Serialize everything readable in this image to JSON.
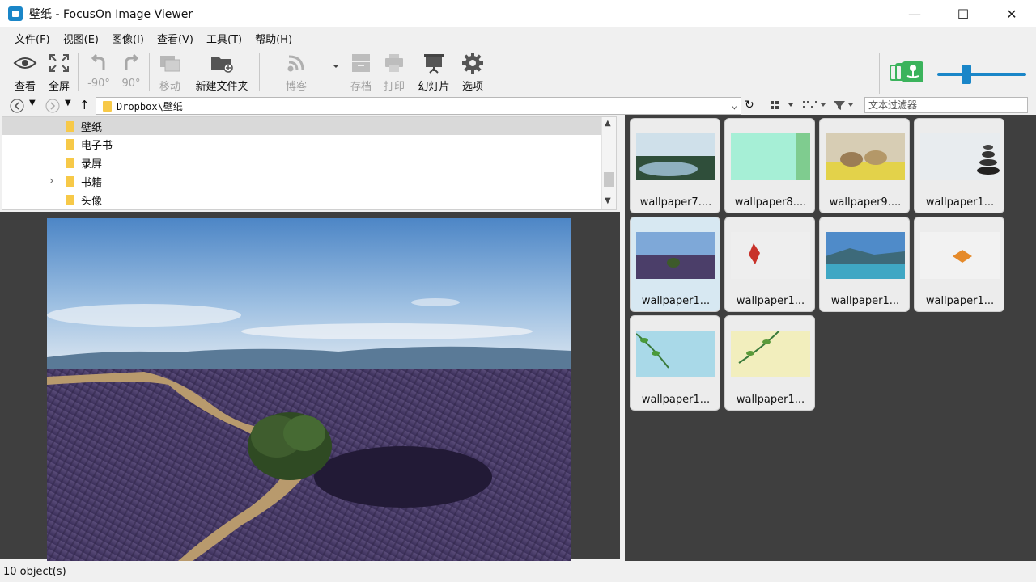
{
  "window": {
    "title": "壁纸 - FocusOn Image Viewer",
    "minimize": "—",
    "maximize": "☐",
    "close": "✕"
  },
  "menu": [
    "文件(F)",
    "视图(E)",
    "图像(I)",
    "查看(V)",
    "工具(T)",
    "帮助(H)"
  ],
  "toolbar": {
    "view": "查看",
    "fullscreen": "全屏",
    "rotate_left": "-90°",
    "rotate_right": "90°",
    "move": "移动",
    "new_folder": "新建文件夹",
    "blog": "博客",
    "archive": "存档",
    "print": "打印",
    "slideshow": "幻灯片",
    "options": "选项"
  },
  "address": {
    "path": "Dropbox\\壁纸",
    "filter_placeholder": "文本过滤器"
  },
  "tree": [
    {
      "label": "壁纸",
      "selected": true,
      "expander": ""
    },
    {
      "label": "电子书",
      "selected": false,
      "expander": ""
    },
    {
      "label": "录屏",
      "selected": false,
      "expander": ""
    },
    {
      "label": "书籍",
      "selected": false,
      "expander": "›"
    },
    {
      "label": "头像",
      "selected": false,
      "expander": ""
    }
  ],
  "thumbnails": [
    {
      "caption": "wallpaper7....",
      "selected": false
    },
    {
      "caption": "wallpaper8....",
      "selected": false
    },
    {
      "caption": "wallpaper9....",
      "selected": false
    },
    {
      "caption": "wallpaper1...",
      "selected": false
    },
    {
      "caption": "wallpaper1...",
      "selected": true
    },
    {
      "caption": "wallpaper1...",
      "selected": false
    },
    {
      "caption": "wallpaper1...",
      "selected": false
    },
    {
      "caption": "wallpaper1...",
      "selected": false
    },
    {
      "caption": "wallpaper1...",
      "selected": false
    },
    {
      "caption": "wallpaper1...",
      "selected": false
    }
  ],
  "status": {
    "text": "10 object(s)"
  },
  "colors": {
    "accent": "#1a86c8",
    "slideshow_green": "#3bb35c",
    "dark_bg": "#3f3f3f"
  }
}
